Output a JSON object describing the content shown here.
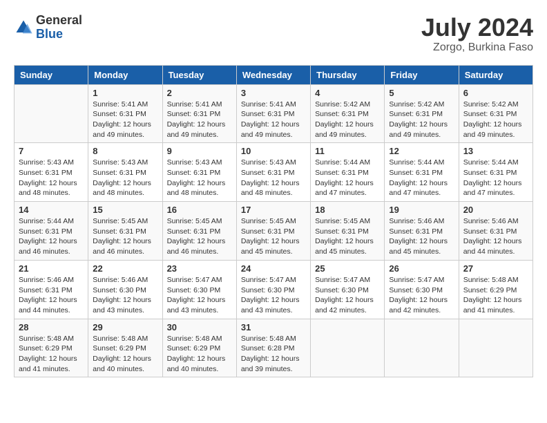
{
  "header": {
    "logo_general": "General",
    "logo_blue": "Blue",
    "month_title": "July 2024",
    "location": "Zorgo, Burkina Faso"
  },
  "calendar": {
    "days_of_week": [
      "Sunday",
      "Monday",
      "Tuesday",
      "Wednesday",
      "Thursday",
      "Friday",
      "Saturday"
    ],
    "weeks": [
      [
        {
          "day": "",
          "info": ""
        },
        {
          "day": "1",
          "info": "Sunrise: 5:41 AM\nSunset: 6:31 PM\nDaylight: 12 hours\nand 49 minutes."
        },
        {
          "day": "2",
          "info": "Sunrise: 5:41 AM\nSunset: 6:31 PM\nDaylight: 12 hours\nand 49 minutes."
        },
        {
          "day": "3",
          "info": "Sunrise: 5:41 AM\nSunset: 6:31 PM\nDaylight: 12 hours\nand 49 minutes."
        },
        {
          "day": "4",
          "info": "Sunrise: 5:42 AM\nSunset: 6:31 PM\nDaylight: 12 hours\nand 49 minutes."
        },
        {
          "day": "5",
          "info": "Sunrise: 5:42 AM\nSunset: 6:31 PM\nDaylight: 12 hours\nand 49 minutes."
        },
        {
          "day": "6",
          "info": "Sunrise: 5:42 AM\nSunset: 6:31 PM\nDaylight: 12 hours\nand 49 minutes."
        }
      ],
      [
        {
          "day": "7",
          "info": "Sunrise: 5:43 AM\nSunset: 6:31 PM\nDaylight: 12 hours\nand 48 minutes."
        },
        {
          "day": "8",
          "info": "Sunrise: 5:43 AM\nSunset: 6:31 PM\nDaylight: 12 hours\nand 48 minutes."
        },
        {
          "day": "9",
          "info": "Sunrise: 5:43 AM\nSunset: 6:31 PM\nDaylight: 12 hours\nand 48 minutes."
        },
        {
          "day": "10",
          "info": "Sunrise: 5:43 AM\nSunset: 6:31 PM\nDaylight: 12 hours\nand 48 minutes."
        },
        {
          "day": "11",
          "info": "Sunrise: 5:44 AM\nSunset: 6:31 PM\nDaylight: 12 hours\nand 47 minutes."
        },
        {
          "day": "12",
          "info": "Sunrise: 5:44 AM\nSunset: 6:31 PM\nDaylight: 12 hours\nand 47 minutes."
        },
        {
          "day": "13",
          "info": "Sunrise: 5:44 AM\nSunset: 6:31 PM\nDaylight: 12 hours\nand 47 minutes."
        }
      ],
      [
        {
          "day": "14",
          "info": "Sunrise: 5:44 AM\nSunset: 6:31 PM\nDaylight: 12 hours\nand 46 minutes."
        },
        {
          "day": "15",
          "info": "Sunrise: 5:45 AM\nSunset: 6:31 PM\nDaylight: 12 hours\nand 46 minutes."
        },
        {
          "day": "16",
          "info": "Sunrise: 5:45 AM\nSunset: 6:31 PM\nDaylight: 12 hours\nand 46 minutes."
        },
        {
          "day": "17",
          "info": "Sunrise: 5:45 AM\nSunset: 6:31 PM\nDaylight: 12 hours\nand 45 minutes."
        },
        {
          "day": "18",
          "info": "Sunrise: 5:45 AM\nSunset: 6:31 PM\nDaylight: 12 hours\nand 45 minutes."
        },
        {
          "day": "19",
          "info": "Sunrise: 5:46 AM\nSunset: 6:31 PM\nDaylight: 12 hours\nand 45 minutes."
        },
        {
          "day": "20",
          "info": "Sunrise: 5:46 AM\nSunset: 6:31 PM\nDaylight: 12 hours\nand 44 minutes."
        }
      ],
      [
        {
          "day": "21",
          "info": "Sunrise: 5:46 AM\nSunset: 6:31 PM\nDaylight: 12 hours\nand 44 minutes."
        },
        {
          "day": "22",
          "info": "Sunrise: 5:46 AM\nSunset: 6:30 PM\nDaylight: 12 hours\nand 43 minutes."
        },
        {
          "day": "23",
          "info": "Sunrise: 5:47 AM\nSunset: 6:30 PM\nDaylight: 12 hours\nand 43 minutes."
        },
        {
          "day": "24",
          "info": "Sunrise: 5:47 AM\nSunset: 6:30 PM\nDaylight: 12 hours\nand 43 minutes."
        },
        {
          "day": "25",
          "info": "Sunrise: 5:47 AM\nSunset: 6:30 PM\nDaylight: 12 hours\nand 42 minutes."
        },
        {
          "day": "26",
          "info": "Sunrise: 5:47 AM\nSunset: 6:30 PM\nDaylight: 12 hours\nand 42 minutes."
        },
        {
          "day": "27",
          "info": "Sunrise: 5:48 AM\nSunset: 6:29 PM\nDaylight: 12 hours\nand 41 minutes."
        }
      ],
      [
        {
          "day": "28",
          "info": "Sunrise: 5:48 AM\nSunset: 6:29 PM\nDaylight: 12 hours\nand 41 minutes."
        },
        {
          "day": "29",
          "info": "Sunrise: 5:48 AM\nSunset: 6:29 PM\nDaylight: 12 hours\nand 40 minutes."
        },
        {
          "day": "30",
          "info": "Sunrise: 5:48 AM\nSunset: 6:29 PM\nDaylight: 12 hours\nand 40 minutes."
        },
        {
          "day": "31",
          "info": "Sunrise: 5:48 AM\nSunset: 6:28 PM\nDaylight: 12 hours\nand 39 minutes."
        },
        {
          "day": "",
          "info": ""
        },
        {
          "day": "",
          "info": ""
        },
        {
          "day": "",
          "info": ""
        }
      ]
    ]
  }
}
